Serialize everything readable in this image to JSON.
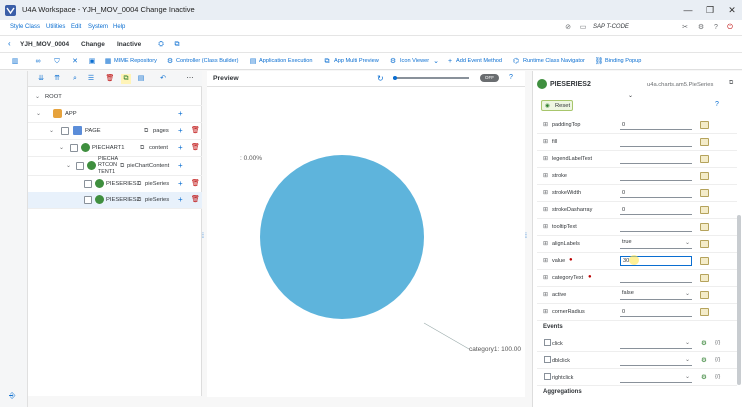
{
  "window": {
    "title": "U4A Workspace - YJH_MOV_0004 Change Inactive",
    "controls": [
      "—",
      "❐",
      "✕"
    ]
  },
  "menu": {
    "items": [
      "Style Class",
      "Utilities",
      "Edit",
      "System",
      "Help"
    ],
    "tcode_label": "SAP T-CODE"
  },
  "header": {
    "app_id": "YJH_MOV_0004",
    "mode": "Change",
    "status": "Inactive"
  },
  "toolbar": {
    "mime": "MIME Repository",
    "controller": "Controller (Class Builder)",
    "app_exec": "Application Execution",
    "multi_preview": "App Multi Preview",
    "icon_viewer": "Icon Viewer",
    "add_event": "Add Event Method",
    "runtime_nav": "Runtime Class Navigator",
    "binding_popup": "Binding Popup"
  },
  "tree": {
    "rows": [
      {
        "label": "ROOT",
        "agg": ""
      },
      {
        "label": "APP",
        "agg": ""
      },
      {
        "label": "PAGE",
        "agg": "pages"
      },
      {
        "label": "PIECHART1",
        "agg": "content"
      },
      {
        "label": "PIECHA RTCON TENT1",
        "agg": "pieChartContent"
      },
      {
        "label": "PIESERIES1",
        "agg": "pieSeries"
      },
      {
        "label": "PIESERIES2",
        "agg": "pieSeries"
      }
    ]
  },
  "preview": {
    "title": "Preview",
    "toggle_label": "OFF"
  },
  "chart_data": {
    "type": "pie",
    "categories": [
      "category1"
    ],
    "values": [
      100
    ],
    "labels": [
      ": 0.00%",
      "category1: 100.00"
    ],
    "colors": [
      "#5eb4dc"
    ]
  },
  "props": {
    "title": "PIESERIES2",
    "type": "u4a.charts.am5.PieSeries",
    "reset": "Reset",
    "rows": [
      {
        "label": "paddingTop",
        "kind": "input",
        "value": "0"
      },
      {
        "label": "fill",
        "kind": "input",
        "value": ""
      },
      {
        "label": "legendLabelText",
        "kind": "input",
        "value": ""
      },
      {
        "label": "stroke",
        "kind": "input",
        "value": ""
      },
      {
        "label": "strokeWidth",
        "kind": "input",
        "value": "0"
      },
      {
        "label": "strokeDasharray",
        "kind": "input",
        "value": "0"
      },
      {
        "label": "tooltipText",
        "kind": "input",
        "value": ""
      },
      {
        "label": "alignLabels",
        "kind": "select",
        "value": "true"
      },
      {
        "label": "value",
        "kind": "input",
        "value": "30",
        "required": true
      },
      {
        "label": "categoryText",
        "kind": "input",
        "value": "",
        "required": true
      },
      {
        "label": "active",
        "kind": "select",
        "value": "false"
      },
      {
        "label": "cornerRadius",
        "kind": "input",
        "value": "0"
      }
    ],
    "events_title": "Events",
    "events": [
      {
        "label": "click"
      },
      {
        "label": "dblclick"
      },
      {
        "label": "rightclick"
      }
    ],
    "event_code": "{/}",
    "aggregations_title": "Aggregations"
  }
}
